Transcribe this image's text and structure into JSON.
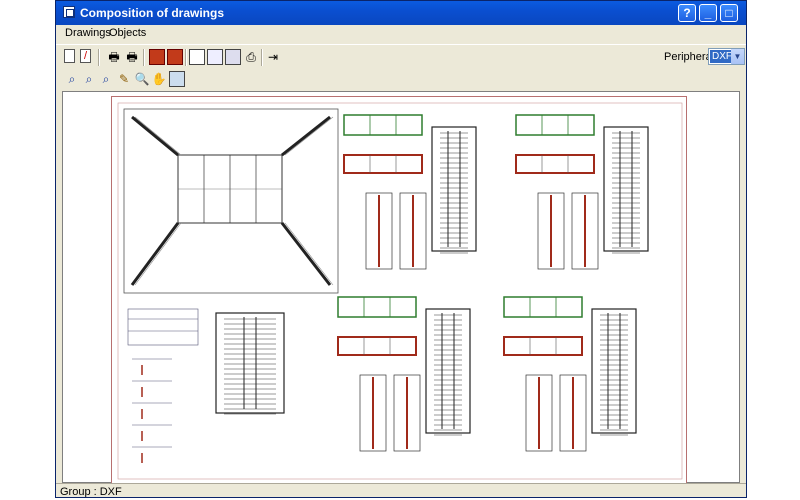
{
  "window": {
    "title": "Composition of drawings",
    "buttons": {
      "help": "?",
      "minimize": "_",
      "maximize": "□",
      "close": "✕"
    }
  },
  "menu": [
    {
      "label": "Drawings",
      "underline": "D"
    },
    {
      "label": "Objects",
      "underline": "O"
    }
  ],
  "toolbar": {
    "peripherals_label": "Peripherals",
    "peripherals_value": "DXF",
    "icons_row1": [
      "new-icon",
      "delete-icon",
      "print-icon",
      "print-setup-icon",
      "import-icon",
      "export-icon",
      "layout-icon",
      "page-icon",
      "drawing-icon",
      "printer-icon",
      "exit-icon"
    ],
    "icons_row2": [
      "zoom-all-icon",
      "zoom-window-icon",
      "zoom-previous-icon",
      "redraw-icon",
      "zoom-icon",
      "pan-icon",
      "properties-icon"
    ]
  },
  "status": {
    "text": "Group : DXF"
  },
  "colors": {
    "title_bar": "#0a4fd0",
    "sheet_border": "#b87070",
    "drawing_green": "#2f7d2f",
    "drawing_red": "#a02a1a"
  }
}
